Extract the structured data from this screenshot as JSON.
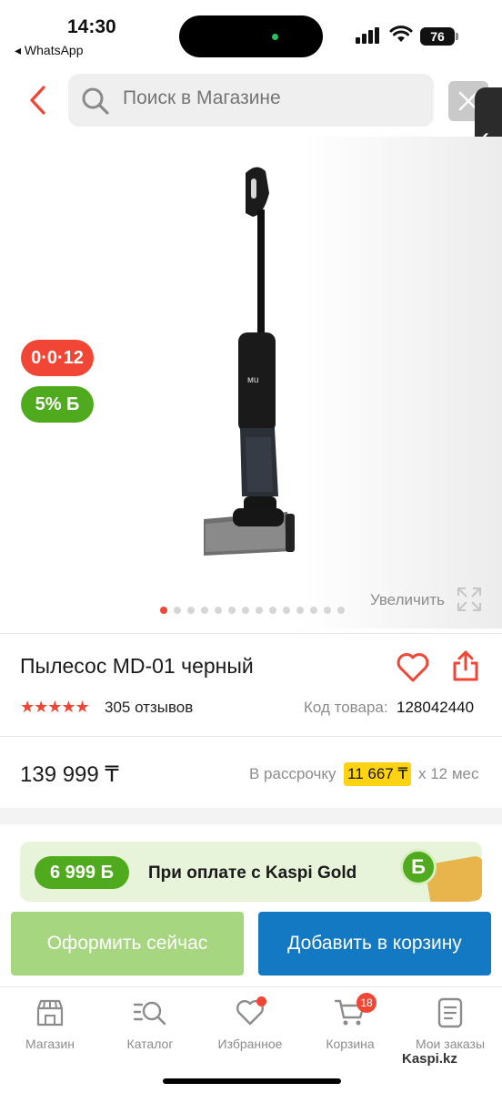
{
  "status_bar": {
    "time": "14:30",
    "back_app": "◂ WhatsApp",
    "battery": "76"
  },
  "header": {
    "search_placeholder": "Поиск в Магазине",
    "icons": [
      "chevron-left-icon",
      "search-icon",
      "close-icon",
      "chevron-left-icon"
    ]
  },
  "product_image": {
    "badge_installment": "0·0·12",
    "badge_bonus": "5% Б",
    "zoom_label": "Увеличить",
    "slide_count": 14,
    "active_slide": 1
  },
  "product": {
    "title": "Пылесос MD-01 черный",
    "rating_stars": "★★★★★",
    "reviews": "305 отзывов",
    "code_label": "Код товара:",
    "code_value": "128042440",
    "price": "139 999 ₸",
    "installment_label": "В рассрочку",
    "installment_amount": "11 667 ₸",
    "installment_months": "х 12 мес"
  },
  "gold_banner": {
    "bonus": "6 999 Б",
    "text": "При оплате с Kaspi Gold",
    "coin_glyph": "Б"
  },
  "actions": {
    "buy_now": "Оформить сейчас",
    "add_to_cart": "Добавить в корзину"
  },
  "bottom_nav": {
    "items": [
      {
        "label": "Магазин",
        "icon": "store-icon"
      },
      {
        "label": "Каталог",
        "icon": "catalog-icon"
      },
      {
        "label": "Избранное",
        "icon": "heart-icon"
      },
      {
        "label": "Корзина",
        "icon": "cart-icon"
      },
      {
        "label": "Мои заказы",
        "icon": "orders-icon"
      }
    ],
    "cart_count": "18",
    "watermark": "Kaspi.kz"
  },
  "colors": {
    "accent_red": "#f14635",
    "bonus_green": "#4fab1d",
    "cart_blue": "#1379c2",
    "buy_green": "#a6d67f",
    "installment_yellow": "#fed313"
  }
}
